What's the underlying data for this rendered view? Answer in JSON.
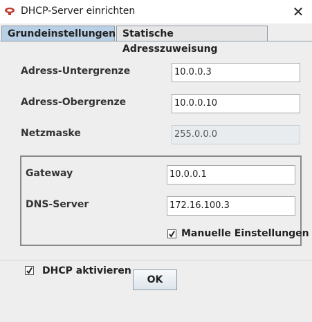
{
  "window": {
    "title": "DHCP-Server einrichten",
    "icon": "router-icon",
    "close_glyph": "✕"
  },
  "tabs": [
    {
      "label": "Grundeinstellungen",
      "active": true
    },
    {
      "label": "Statische Adresszuweisung",
      "active": false
    }
  ],
  "fields": {
    "lower_bound": {
      "label": "Adress-Untergrenze",
      "value": "10.0.0.3"
    },
    "upper_bound": {
      "label": "Adress-Obergrenze",
      "value": "10.0.0.10"
    },
    "netmask": {
      "label": "Netzmaske",
      "value": "255.0.0.0",
      "editable": false
    },
    "gateway": {
      "label": "Gateway",
      "value": "10.0.0.1"
    },
    "dns": {
      "label": "DNS-Server",
      "value": "172.16.100.3"
    }
  },
  "checkboxes": {
    "manual": {
      "label": "Manuelle Einstellungen",
      "checked": true
    },
    "dhcp": {
      "label": "DHCP aktivieren",
      "checked": true
    }
  },
  "buttons": {
    "ok": "OK"
  },
  "colors": {
    "active_tab": "#b8cfe5",
    "icon_red": "#c0392b",
    "body_bg": "#eeeeee"
  }
}
